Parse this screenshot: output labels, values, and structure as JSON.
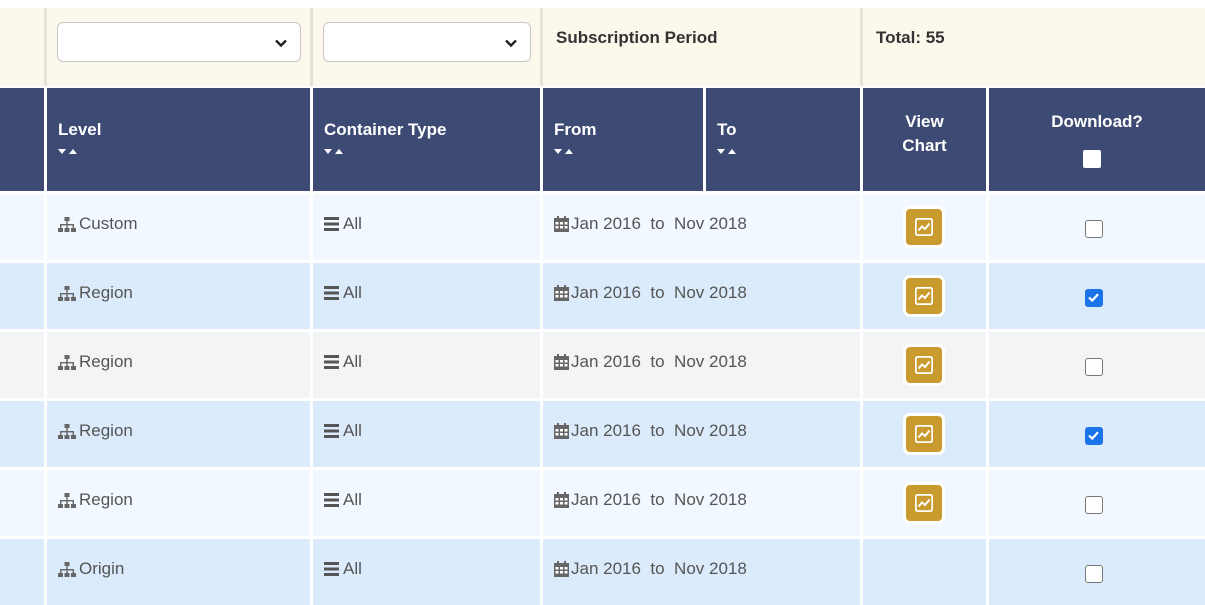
{
  "filters": {
    "level_select": "",
    "container_select": "",
    "period_label": "Subscription Period",
    "total_label": "Total: 55"
  },
  "header": {
    "level": "Level",
    "container_type": "Container Type",
    "from": "From",
    "to": "To",
    "view_chart_line1": "View",
    "view_chart_line2": "Chart",
    "download": "Download?"
  },
  "rows": [
    {
      "level": "Custom",
      "container": "All",
      "from": "Jan 2016",
      "sep": "to",
      "to": "Nov 2018",
      "chart": true,
      "download": false,
      "shade": "light"
    },
    {
      "level": "Region",
      "container": "All",
      "from": "Jan 2016",
      "sep": "to",
      "to": "Nov 2018",
      "chart": true,
      "download": true,
      "shade": "blue"
    },
    {
      "level": "Region",
      "container": "All",
      "from": "Jan 2016",
      "sep": "to",
      "to": "Nov 2018",
      "chart": true,
      "download": false,
      "shade": "gray"
    },
    {
      "level": "Region",
      "container": "All",
      "from": "Jan 2016",
      "sep": "to",
      "to": "Nov 2018",
      "chart": true,
      "download": true,
      "shade": "blue"
    },
    {
      "level": "Region",
      "container": "All",
      "from": "Jan 2016",
      "sep": "to",
      "to": "Nov 2018",
      "chart": true,
      "download": false,
      "shade": "light"
    },
    {
      "level": "Origin",
      "container": "All",
      "from": "Jan 2016",
      "sep": "to",
      "to": "Nov 2018",
      "chart": false,
      "download": false,
      "shade": "blue"
    }
  ],
  "colors": {
    "header_bg": "#3d4a73",
    "filter_bg": "#fdf8ec",
    "chart_button": "#c99a2e",
    "checkbox_checked": "#1a73e8"
  },
  "icons": {
    "level": "sitemap-icon",
    "container": "list-icon",
    "period": "calendar-icon",
    "chart": "line-chart-icon",
    "select": "chevron-down-icon",
    "sort": "sort-arrows-icon"
  }
}
